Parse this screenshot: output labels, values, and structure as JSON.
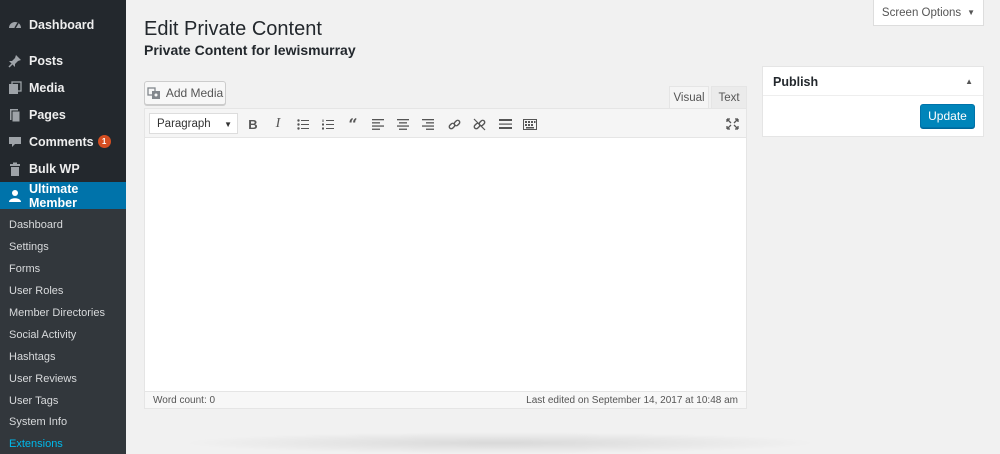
{
  "sidebar": {
    "items": [
      {
        "label": "Dashboard",
        "icon": "dashboard-icon"
      },
      {
        "label": "Posts",
        "icon": "pin-icon"
      },
      {
        "label": "Media",
        "icon": "media-icon"
      },
      {
        "label": "Pages",
        "icon": "pages-icon"
      },
      {
        "label": "Comments",
        "icon": "comment-icon",
        "badge": "1"
      },
      {
        "label": "Bulk WP",
        "icon": "trash-icon"
      },
      {
        "label": "Ultimate Member",
        "icon": "user-icon",
        "current": true
      }
    ],
    "submenu": [
      {
        "label": "Dashboard"
      },
      {
        "label": "Settings"
      },
      {
        "label": "Forms"
      },
      {
        "label": "User Roles"
      },
      {
        "label": "Member Directories"
      },
      {
        "label": "Social Activity"
      },
      {
        "label": "Hashtags"
      },
      {
        "label": "User Reviews"
      },
      {
        "label": "User Tags"
      },
      {
        "label": "System Info"
      },
      {
        "label": "Extensions",
        "active": true
      }
    ]
  },
  "header": {
    "screen_options": "Screen Options",
    "title": "Edit Private Content",
    "subtitle": "Private Content for lewismurray"
  },
  "editor": {
    "add_media": "Add Media",
    "tabs": {
      "visual": "Visual",
      "text": "Text"
    },
    "format_select": "Paragraph",
    "toolbar_icons": [
      "bold-icon",
      "italic-icon",
      "bullet-list-icon",
      "numbered-list-icon",
      "blockquote-icon",
      "align-left-icon",
      "align-center-icon",
      "align-right-icon",
      "link-icon",
      "unlink-icon",
      "read-more-icon",
      "toolbar-toggle-icon",
      "fullscreen-icon"
    ],
    "word_count": "Word count: 0",
    "last_edited": "Last edited on September 14, 2017 at 10:48 am"
  },
  "publish": {
    "title": "Publish",
    "update_label": "Update"
  },
  "colors": {
    "sidebar_bg": "#23282d",
    "submenu_bg": "#32373c",
    "accent": "#0073aa",
    "button": "#0085ba",
    "badge": "#d54e21",
    "active_link": "#00b9eb"
  }
}
